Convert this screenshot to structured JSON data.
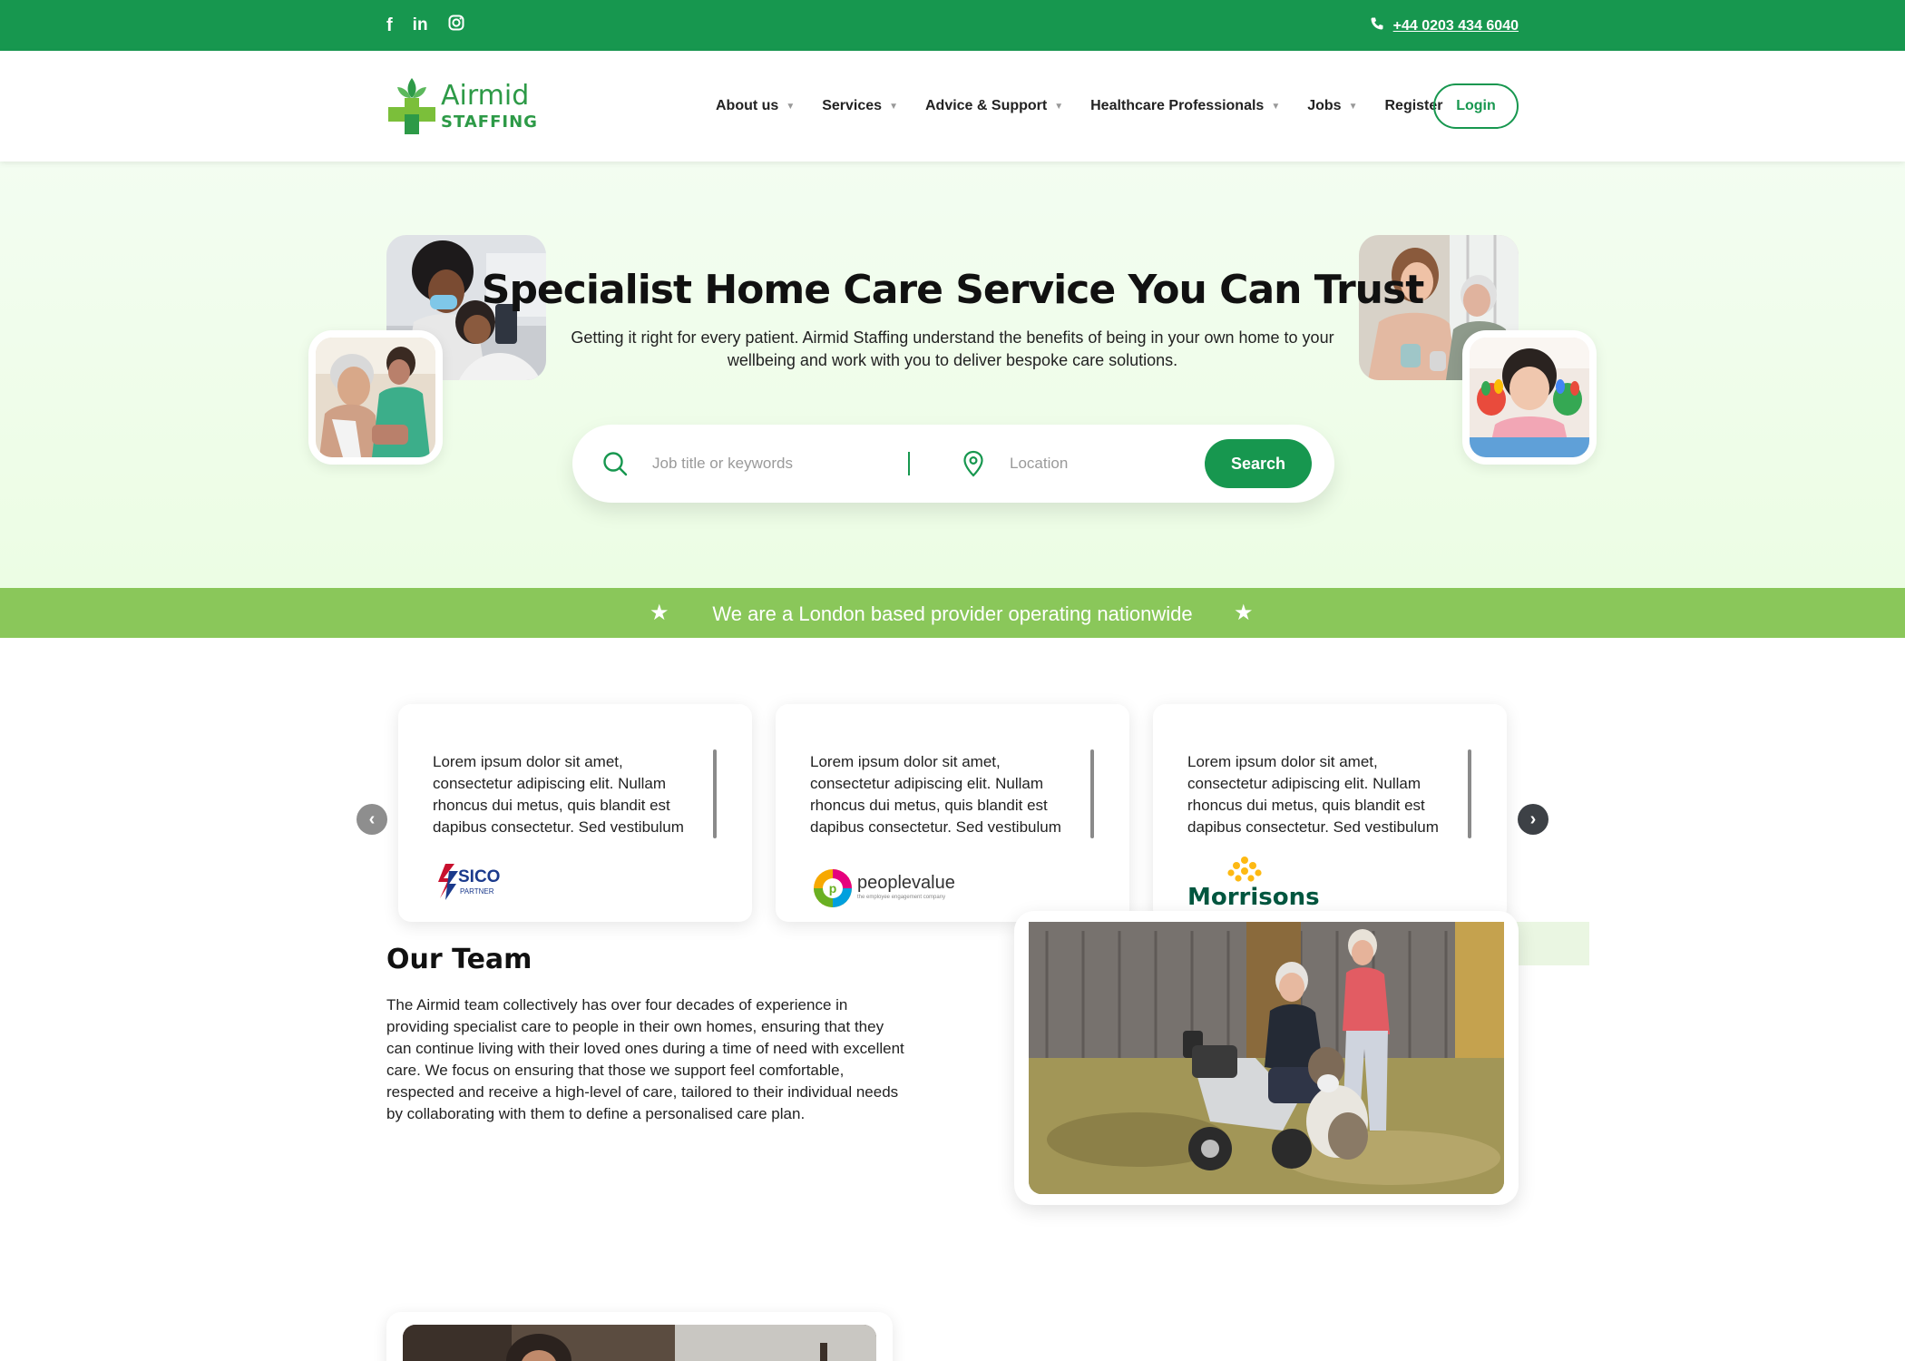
{
  "topbar": {
    "social": [
      "facebook-icon",
      "linkedin-icon",
      "instagram-icon"
    ],
    "phone": "+44 0203 434 6040"
  },
  "logo": {
    "line1": "Airmid",
    "line2": "STAFFING"
  },
  "nav": {
    "items": [
      {
        "label": "About us",
        "dropdown": true
      },
      {
        "label": "Services",
        "dropdown": true
      },
      {
        "label": "Advice & Support",
        "dropdown": true
      },
      {
        "label": "Healthcare Professionals",
        "dropdown": true
      },
      {
        "label": "Jobs",
        "dropdown": true
      },
      {
        "label": "Register",
        "dropdown": false
      }
    ],
    "login": "Login"
  },
  "hero": {
    "title": "Specialist Home Care Service You Can Trust",
    "subtitle": "Getting it right for every patient. Airmid Staffing understand the benefits of being in your own home to your wellbeing and work with you to deliver bespoke care solutions.",
    "search": {
      "keywords_placeholder": "Job title or keywords",
      "location_placeholder": "Location",
      "button": "Search"
    }
  },
  "banner": {
    "text": "We are a London based provider operating nationwide"
  },
  "testimonials": [
    {
      "text": "Lorem ipsum dolor sit amet, consectetur adipiscing elit. Nullam rhoncus dui metus, quis blandit est dapibus consectetur. Sed vestibulum",
      "logo": "SICO",
      "logo_sub": "PARTNER"
    },
    {
      "text": "Lorem ipsum dolor sit amet, consectetur adipiscing elit. Nullam rhoncus dui metus, quis blandit est dapibus consectetur. Sed vestibulum",
      "logo": "peoplevalue",
      "logo_sub": "the employee engagement company"
    },
    {
      "text": "Lorem ipsum dolor sit amet, consectetur adipiscing elit. Nullam rhoncus dui metus, quis blandit est dapibus consectetur. Sed vestibulum",
      "logo": "Morrisons",
      "logo_sub": ""
    }
  ],
  "team": {
    "title": "Our Team",
    "text": "The Airmid team collectively has over four decades of experience in providing specialist care to people in their own homes, ensuring that they can continue living with their loved ones during a time of need with excellent care. We focus on ensuring that those we support feel comfortable, respected and receive a high-level of care, tailored to their individual needs by collaborating with them to define a personalised care plan."
  },
  "colors": {
    "primary": "#17974f",
    "banner": "#8ac75a",
    "hero_bg": "#f0fdea"
  }
}
